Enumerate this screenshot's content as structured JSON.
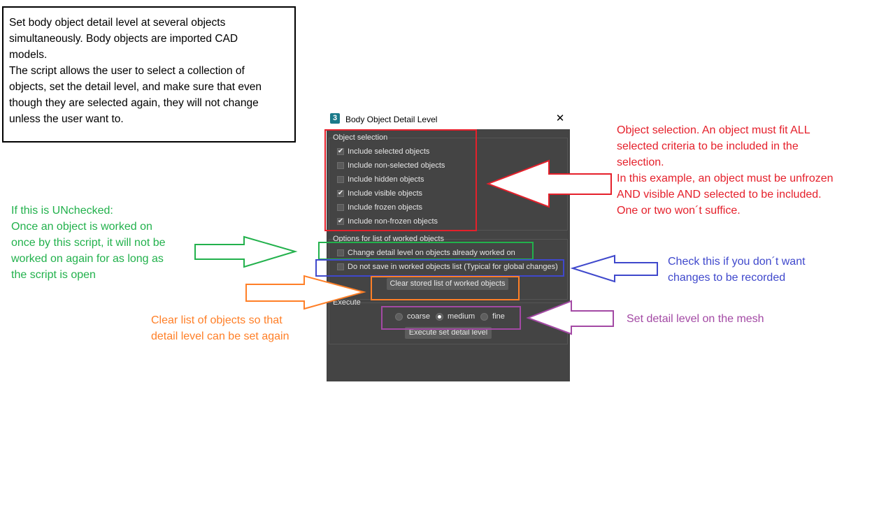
{
  "description": {
    "lines": [
      "Set body object detail level at several objects",
      "simultaneously. Body objects are imported CAD",
      "models.",
      "The script allows the user to select a collection of",
      "objects, set the detail level, and make sure that even",
      "though they are selected again, they will not change",
      "unless the user want to."
    ]
  },
  "window": {
    "app_icon": "3",
    "title": "Body Object Detail Level",
    "close_symbol": "✕"
  },
  "object_selection": {
    "label": "Object selection",
    "items": [
      {
        "label": "Include selected objects",
        "checked": true
      },
      {
        "label": "Include non-selected objects",
        "checked": false
      },
      {
        "label": "Include hidden objects",
        "checked": false
      },
      {
        "label": "Include visible objects",
        "checked": true
      },
      {
        "label": "Include frozen objects",
        "checked": false
      },
      {
        "label": "Include non-frozen objects",
        "checked": true
      }
    ]
  },
  "worked_options": {
    "label": "Options for list of worked objects",
    "change_detail_label": "Change detail level on objects already worked on",
    "change_detail_checked": false,
    "do_not_save_label": "Do not save in worked objects list (Typical for global changes)",
    "do_not_save_checked": false,
    "clear_button": "Clear stored list of worked objects"
  },
  "execute": {
    "label": "Execute",
    "options": [
      "coarse",
      "medium",
      "fine"
    ],
    "selected": "medium",
    "button": "Execute set detail level"
  },
  "annotations": {
    "object_selection": [
      "Object selection. An object must fit ALL",
      "selected criteria to be included in the",
      "selection.",
      "In this example, an object must be unfrozen",
      "AND visible AND selected to be included.",
      "One or two won´t suffice."
    ],
    "unchecked": [
      "If this is UNchecked:",
      "Once an object is worked on",
      "once by this script, it will not be",
      "worked on again for as long as",
      "the script is open"
    ],
    "do_not_save": [
      "Check this if you don´t want",
      "changes to be recorded"
    ],
    "clear_list": [
      "Clear list of objects so that",
      "detail level can be set again"
    ],
    "set_detail": [
      "Set detail level on the mesh"
    ]
  },
  "colors": {
    "red": "#e5202b",
    "green": "#22b14c",
    "blue": "#3f48cc",
    "orange": "#ff7f27",
    "purple": "#a349a4",
    "dialog_bg": "#444444"
  }
}
